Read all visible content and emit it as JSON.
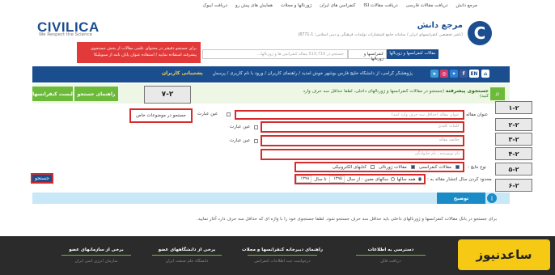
{
  "topnav": [
    "مرجع دانش",
    "دریافت مقالات فارسی",
    "دریافت مقالات ISI",
    "کنفرانس های ایران",
    "ژورنالها و مجلات",
    "همایش های پیش رو",
    "دریافت ایبوک"
  ],
  "brand": {
    "en_name": "CIVILICA",
    "en_tagline": "We Respect the Science",
    "logo_letter": "C",
    "fa_name": "مرجع دانش",
    "fa_tagline": "(ناشر تخصصی کنفرانسهای ایران / سامانه جامع اشتشارات تولیدات فرهنگی و دینی اسلامی؛ 1-8771)"
  },
  "ad": {
    "text": "برای جستجو دقیقتر در محتوای علمی مقالات از بخش جستجوی پیشرفته استفاده نمایید / استفاده عنوان پایان نامه از سیویلیکا"
  },
  "search": {
    "placeholder": "جستجو در 510,710 مقاله کنفرانس ها و ژورنالها...",
    "category": "کنفرانسها و ژورنالها",
    "button": "مقالات کنفرانسها و ژورنالها"
  },
  "bluebar": {
    "welcome": "پژوهشگر گرامی، از دانشگاه خلیج فارس بوشهر خوش آمدید / راهنمای کاربران / ورود با نام کاربری / پرسش",
    "support": "پشتیبانی کاربران",
    "lang_en": "EN",
    "home_icon": "home-icon"
  },
  "advanced": {
    "title_bold": "جستجوی پیشرفته",
    "title_rest": "(جستجو در مقالات کنفرانسها و ژورنالهای داخلی، لطفا حداقل سه حرف وارد کنید)",
    "guide_button": "راهنمای جستجو",
    "conf_list_button": "لیست کنفرانسها",
    "badge": "۷-۲"
  },
  "form": {
    "title_label": "عنوان مقاله",
    "title_placeholder": "عنوان مقاله (حداقل سه حرف وارد کنید)",
    "exact_label": "عین عبارت",
    "special_topics": "جستجو در موضوعات خاص",
    "keywords_placeholder": "کلمات کلیدی",
    "abstract_placeholder": "خلاصه مقاله",
    "author_placeholder": "نام نویسنده ، نام خانوادگی",
    "exact_label_2": "عین عبارت",
    "exact_label_3": "عین عبارت",
    "result_type_label": "نوع نتایج :",
    "result_conf": "مقالات کنفرانسی",
    "result_journal": "مقالات ژورنالی",
    "result_ebook": "کتابهای الکترونیکی",
    "year_label": "محدود کردن سال انتشار مقاله به :",
    "all_years": "همه سالها",
    "specific_years": "سالهای معین : از سال",
    "year_from": "۱۳۹۵",
    "year_to_label": "تا سال",
    "year_to": "۱۳۹۸"
  },
  "badges": [
    "۱-۲",
    "۲-۲",
    "۳-۲",
    "۴-۲",
    "۵-۲",
    "۶-۲"
  ],
  "submit": "جستجو",
  "help": {
    "button": "توضیح",
    "icon": "info-icon",
    "text": "برای جستجو در بانک مقالات کنفرانسها و ژورنالهای داخلی باید حداقل سه حرف جستجو شود. لطفا جستجوی خود را با واژه ای که حداقل سه حرف دارد آغاز نمایید."
  },
  "footer": [
    {
      "title": "دسترسی به اطلاعات",
      "item": "دریافت فایل"
    },
    {
      "title": "راهنمای دبیرخانه کنفرانسها و مجلات",
      "item": "درخواست ثبت اطلاعات کنفرانس"
    },
    {
      "title": "برخی از دانشگاههای عضو",
      "item": "دانشگاه علم صنعت ایران"
    },
    {
      "title": "برخی از سازمانهای عضو",
      "item": "سازمان انرژی اتمی ایران"
    }
  ],
  "watermark": "ساعدنیوز",
  "colors": {
    "brand_blue": "#1b4e8f",
    "green": "#6cba3a",
    "red_highlight": "#d42c2c",
    "help_blue": "#1a8bc7"
  }
}
